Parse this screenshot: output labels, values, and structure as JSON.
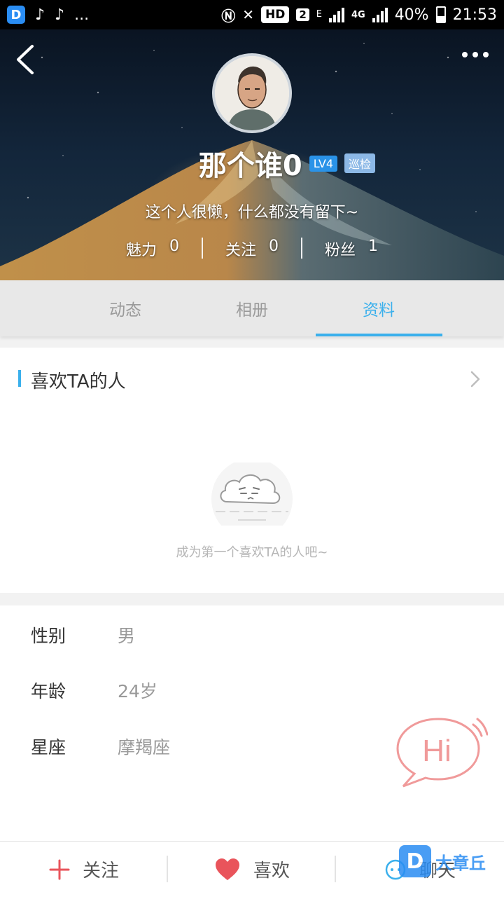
{
  "status_bar": {
    "app_icons": [
      "D",
      "♪",
      "♪"
    ],
    "overflow": "...",
    "hd_badge": "HD",
    "sim_badge": "2",
    "network_e": "E",
    "network_4g": "4G",
    "battery": "40%",
    "time": "21:53"
  },
  "header": {
    "username": "那个谁0",
    "level_badge": "LV4",
    "role_badge": "巡检",
    "bio": "这个人很懒，什么都没有留下~",
    "stats": [
      {
        "label": "魅力",
        "value": "0"
      },
      {
        "label": "关注",
        "value": "0"
      },
      {
        "label": "粉丝",
        "value": "1"
      }
    ]
  },
  "tabs": [
    {
      "label": "动态",
      "active": false
    },
    {
      "label": "相册",
      "active": false
    },
    {
      "label": "资料",
      "active": true
    }
  ],
  "likers": {
    "title": "喜欢TA的人",
    "empty_text": "成为第一个喜欢TA的人吧~"
  },
  "profile_info": [
    {
      "label": "性别",
      "value": "男"
    },
    {
      "label": "年龄",
      "value": "24岁"
    },
    {
      "label": "星座",
      "value": "摩羯座"
    }
  ],
  "hi_bubble": {
    "text": "Hi"
  },
  "bottom_bar": {
    "follow_label": "关注",
    "like_label": "喜欢",
    "chat_label": "聊天"
  },
  "watermark": {
    "logo": "D",
    "text": "大章丘"
  },
  "colors": {
    "accent": "#3bb0ec",
    "level_badge": "#2a93e8",
    "like_heart": "#e9545b",
    "follow_plus": "#e9545b",
    "hi_bubble": "#f09a9a"
  }
}
